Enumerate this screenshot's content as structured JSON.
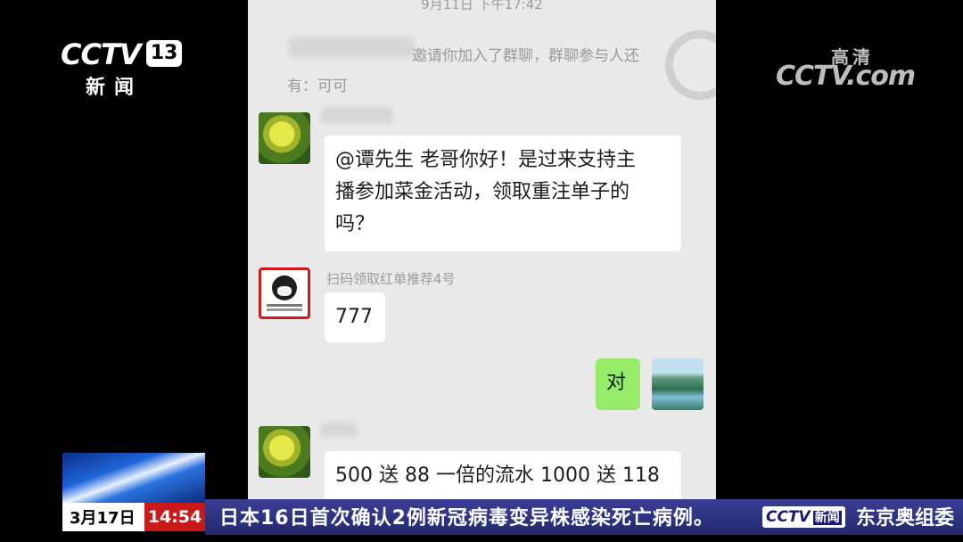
{
  "chat": {
    "timestamp": "9月11日 下午17:42",
    "system_message_line1": "邀请你加入了群聊，群聊参与人还",
    "system_message_line2": "有：可可",
    "messages": [
      {
        "side": "left",
        "avatar": "football-avatar",
        "text_line1": "@谭先生 老哥你好！是过来支持主",
        "text_line2": "播参加菜金活动，领取重注单子的",
        "text_line3": "吗？"
      },
      {
        "side": "left",
        "avatar": "meme-avatar",
        "sender": "扫码领取红单推荐4号",
        "text": "777"
      },
      {
        "side": "right",
        "avatar": "scenery-avatar",
        "text": "对"
      },
      {
        "side": "left",
        "avatar": "football-avatar",
        "text": "500 送 88 一倍的流水 1000 送 118"
      }
    ]
  },
  "logo": {
    "channel_word": "CCTV",
    "channel_number": "13",
    "channel_sub": "新闻",
    "watermark_hd": "高清",
    "watermark_word": "CCTV.com"
  },
  "banner": {
    "date": "3月17日",
    "time": "14:54",
    "ticker": "日本16日首次确认2例新冠病毒变异株感染死亡病例。",
    "ticker_logo": "CCTV",
    "ticker_logo_sub": "新闻",
    "ticker_next": "东京奥组委"
  },
  "colors": {
    "chat_background": "#e9e9e9",
    "outgoing_bubble": "#95ec69",
    "clock_red": "#c81a1a",
    "ticker_blue": "#2d3280"
  }
}
